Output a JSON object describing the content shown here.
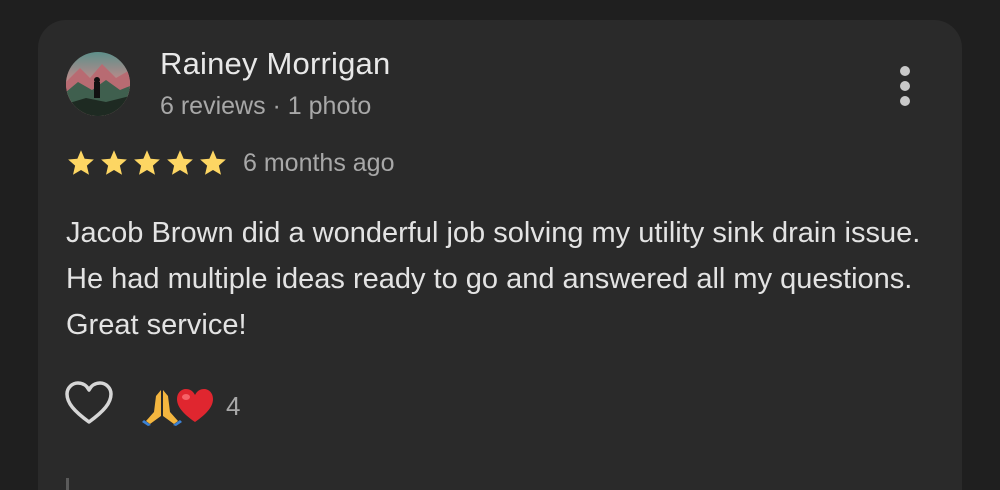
{
  "reviewer": {
    "name": "Rainey Morrigan",
    "meta": "6 reviews · 1 photo"
  },
  "rating": {
    "stars": 5,
    "max": 5,
    "color": "#fdd663"
  },
  "time_ago": "6 months ago",
  "review_text": "Jacob Brown did a wonderful job solving my utility sink drain issue. He had multiple ideas ready to go and answered all my questions. Great service!",
  "reactions": {
    "icons": [
      "folded-hands-emoji",
      "red-heart-emoji"
    ],
    "count": "4"
  },
  "icons": {
    "like": "heart-outline-icon",
    "menu": "more-vert-icon"
  }
}
